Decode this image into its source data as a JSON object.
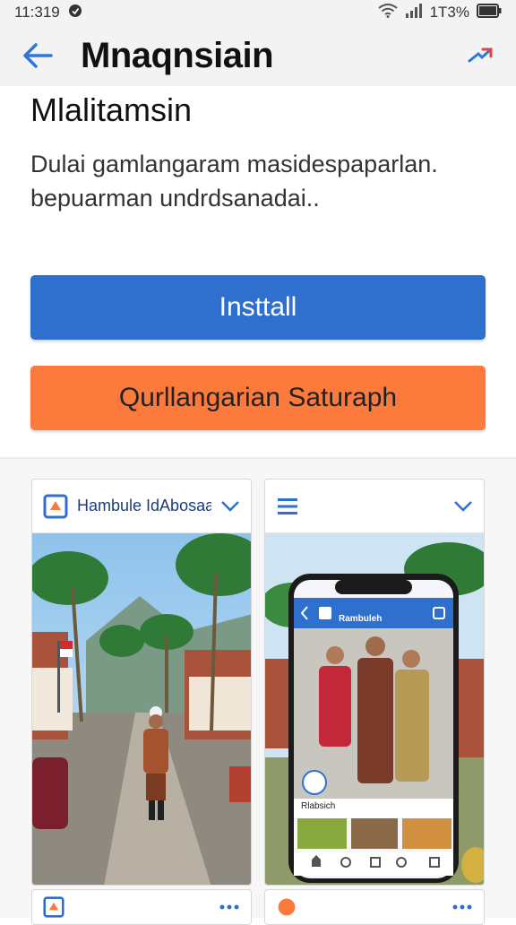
{
  "status_bar": {
    "time": "11:319",
    "battery": "1T3%"
  },
  "app_bar": {
    "title": "Mnaqnsiain"
  },
  "content": {
    "subtitle": "Mlalitamsin",
    "description": "Dulai gamlangaram masidespaparlan. bepuarman undrdsanadai.."
  },
  "buttons": {
    "install_label": "Insttall",
    "secondary_label": "Qurllangarian Saturaph"
  },
  "screenshots": [
    {
      "header_label": "Hambule IdAbosaao",
      "icons": [
        "app-logo-icon",
        "chevron-down-icon"
      ]
    },
    {
      "icons": [
        "menu-icon",
        "chevron-down-icon"
      ],
      "phone_app_label": "Rambuleh",
      "phone_section_label": "Rlabsich"
    }
  ],
  "colors": {
    "install_button": "#2f6fcd",
    "secondary_button": "#fb7a3c",
    "app_bar_bg": "#f3f3f3",
    "accent_blue": "#2f6fcd"
  }
}
